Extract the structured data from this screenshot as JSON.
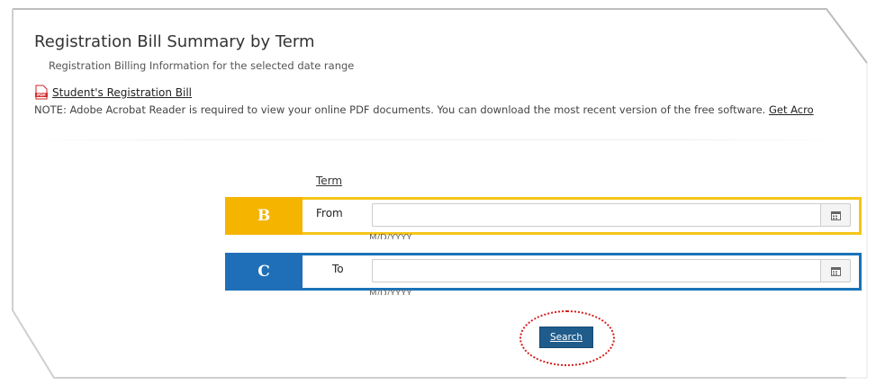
{
  "page": {
    "title": "Registration Bill Summary by Term",
    "subtitle": "Registration Billing Information for the selected date range",
    "pdf_link": "Student's Registration Bill",
    "note_text": "NOTE: Adobe Acrobat Reader is required to view your online PDF documents. You can download the most recent version of the free software. ",
    "note_link": "Get Acro"
  },
  "form": {
    "term_label": "Term",
    "from": {
      "badge": "B",
      "label": "From",
      "value": "",
      "hint": "M/D/YYYY"
    },
    "to": {
      "badge": "C",
      "label": "To",
      "value": "",
      "hint": "M/D/YYYY"
    },
    "search_label": "Search"
  },
  "colors": {
    "badge_b": "#f5b400",
    "badge_c": "#1f6fb8",
    "search_button": "#1f5c8b",
    "highlight_circle": "#d31b1b"
  },
  "icons": {
    "pdf": "pdf-icon",
    "calendar": "calendar-icon"
  }
}
